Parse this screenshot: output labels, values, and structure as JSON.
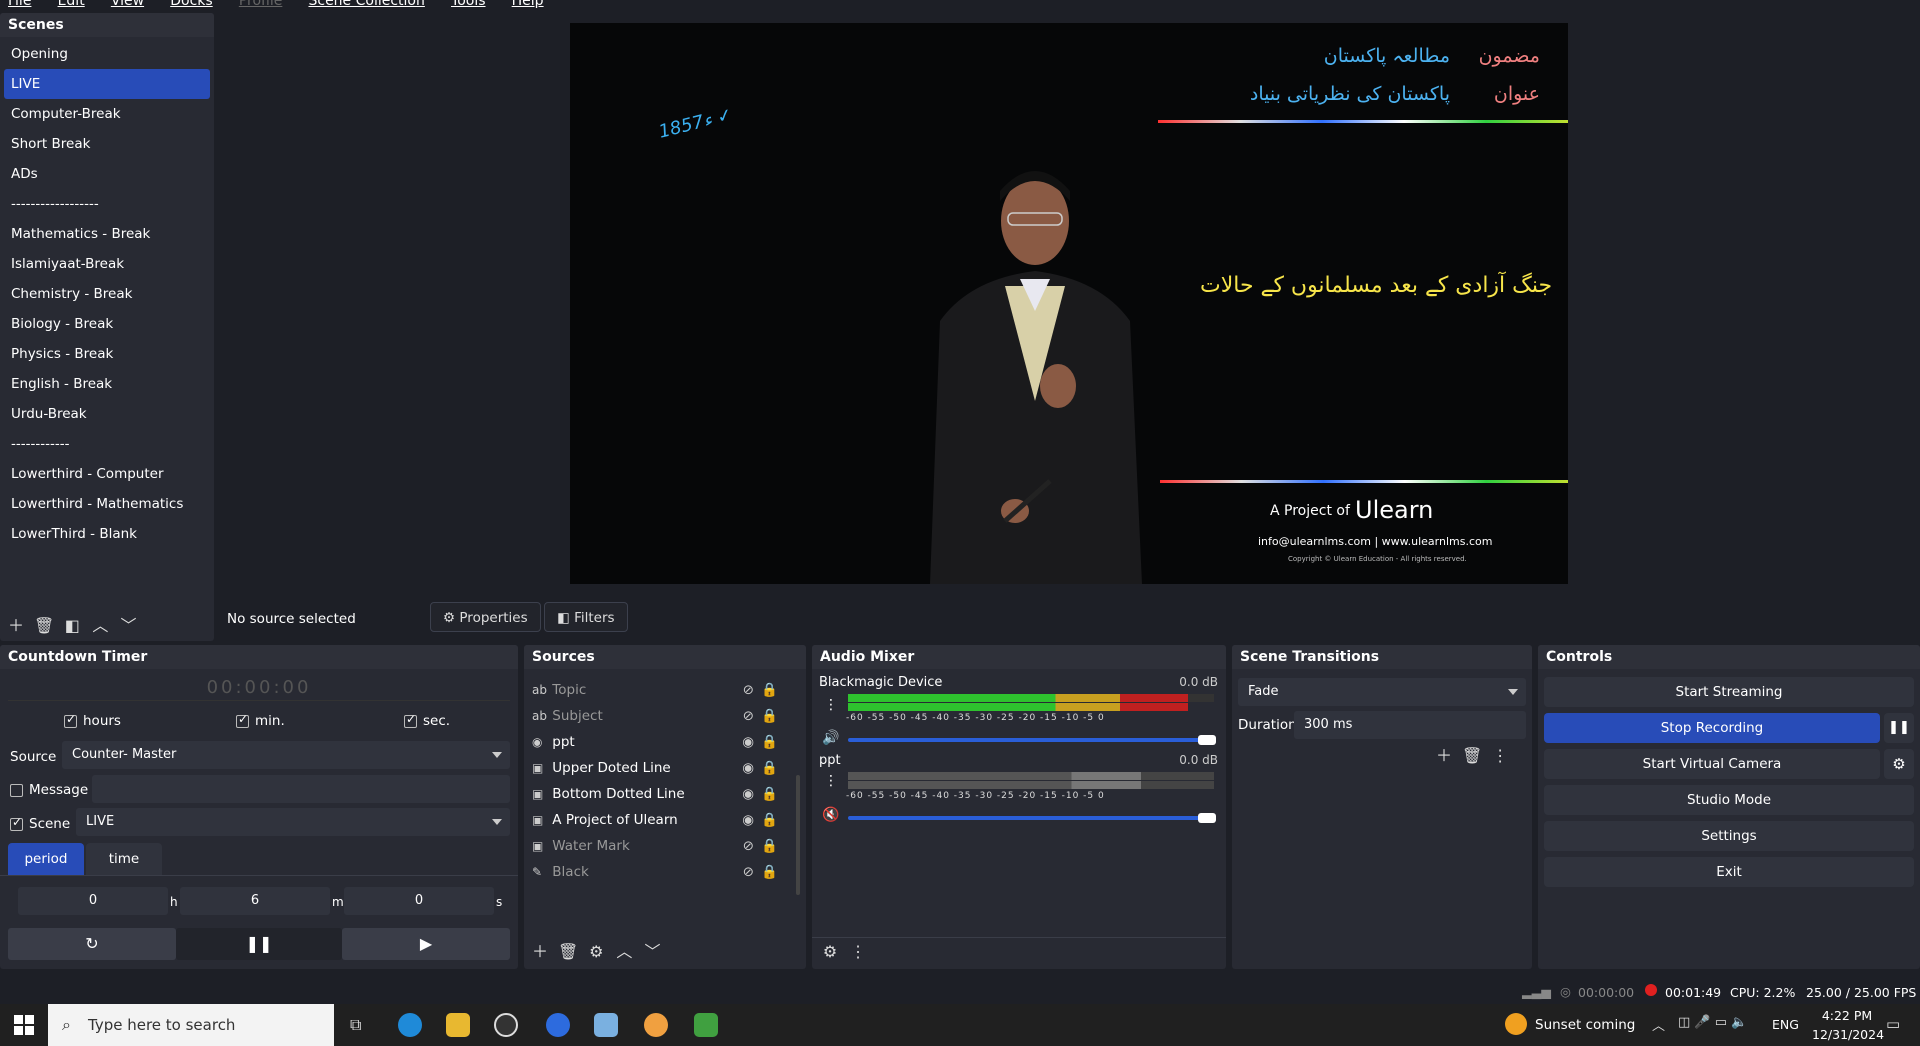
{
  "menu": [
    "File",
    "Edit",
    "View",
    "Docks",
    "Profile",
    "Scene Collection",
    "Tools",
    "Help"
  ],
  "scenes": {
    "title": "Scenes",
    "items": [
      "Opening",
      "LIVE",
      "Computer-Break",
      "Short Break",
      "ADs",
      "------------------",
      "Mathematics  - Break",
      "Islamiyaat-Break",
      "Chemistry  - Break",
      "Biology  - Break",
      "Physics  - Break",
      "English - Break",
      "Urdu-Break",
      "------------",
      "Lowerthird - Computer",
      "Lowerthird - Mathematics",
      "LowerThird - Blank"
    ],
    "selected": "LIVE"
  },
  "preview": {
    "subject_label": "مضمون",
    "subject": "مطالعہ پاکستان",
    "topic_label": "عنوان",
    "topic": "پاکستان کی نظریاتی بنیاد",
    "headline": "جنگ آزادی کے بعد مسلمانوں کے حالات",
    "annotation": "1857ء ✓",
    "project_of": "A Project of",
    "logo": "Ulearn",
    "contact": "info@ulearnlms.com | www.ulearnlms.com",
    "copyright": "Copyright © Ulearn Education - All rights reserved."
  },
  "source_bar": {
    "status": "No source selected",
    "properties": "Properties",
    "filters": "Filters"
  },
  "countdown": {
    "title": "Countdown Timer",
    "display": "00:00:00",
    "hours": "hours",
    "min": "min.",
    "sec": "sec.",
    "source_label": "Source",
    "source_value": "Counter- Master",
    "message_label": "Message",
    "scene_label": "Scene",
    "scene_value": "LIVE",
    "tab_period": "period",
    "tab_time": "time",
    "h_value": "0",
    "h_unit": "h",
    "m_value": "6",
    "m_unit": "m",
    "s_value": "0",
    "s_unit": "s"
  },
  "sources": {
    "title": "Sources",
    "items": [
      {
        "name": "Topic",
        "icon": "text-icon",
        "visible": false
      },
      {
        "name": "Subject",
        "icon": "text-icon",
        "visible": false
      },
      {
        "name": "ppt",
        "icon": "camera-icon",
        "visible": true
      },
      {
        "name": "Upper Doted Line",
        "icon": "image-icon",
        "visible": true
      },
      {
        "name": "Bottom Dotted Line",
        "icon": "image-icon",
        "visible": true
      },
      {
        "name": "A Project of Ulearn",
        "icon": "image-icon",
        "visible": true
      },
      {
        "name": "Water Mark",
        "icon": "image-icon",
        "visible": false
      },
      {
        "name": "Black",
        "icon": "brush-icon",
        "visible": false
      }
    ]
  },
  "mixer": {
    "title": "Audio Mixer",
    "channels": [
      {
        "name": "Blackmagic Device",
        "db": "0.0 dB",
        "level": 0.93,
        "muted": false
      },
      {
        "name": "ppt",
        "db": "0.0 dB",
        "level": 0.0,
        "muted": true
      }
    ],
    "ticks": "-60 -55 -50 -45 -40 -35 -30 -25 -20 -15 -10 -5 0"
  },
  "transitions": {
    "title": "Scene Transitions",
    "selected": "Fade",
    "duration_label": "Duration",
    "duration_value": "300 ms"
  },
  "controls": {
    "title": "Controls",
    "start_streaming": "Start Streaming",
    "stop_recording": "Stop Recording",
    "start_virtual_camera": "Start Virtual Camera",
    "studio_mode": "Studio Mode",
    "settings": "Settings",
    "exit": "Exit"
  },
  "status": {
    "stream_time": "00:00:00",
    "rec_time": "00:01:49",
    "cpu": "CPU: 2.2%",
    "fps": "25.00 / 25.00 FPS"
  },
  "taskbar": {
    "search_placeholder": "Type here to search",
    "weather": "Sunset coming",
    "lang": "ENG",
    "time": "4:22 PM",
    "date": "12/31/2024"
  },
  "colors": {
    "accent": "#284cb8",
    "panel": "#282a33",
    "bg": "#1d1f26",
    "rec": "#e02020"
  }
}
